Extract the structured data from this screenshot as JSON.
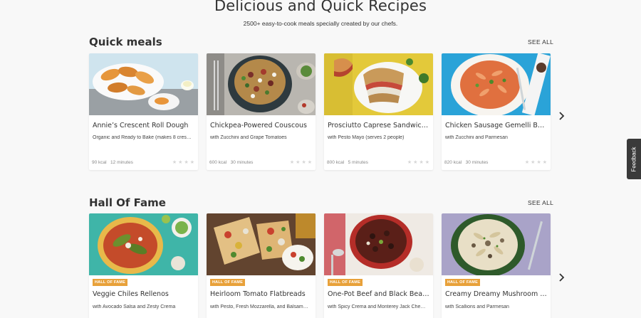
{
  "hero": {
    "title": "Delicious and Quick Recipes",
    "subtitle": "2500+ easy-to-cook meals specially created by our chefs."
  },
  "sections": [
    {
      "title": "Quick meals",
      "see_all": "SEE ALL",
      "cards": [
        {
          "title": "Annie’s Crescent Roll Dough",
          "subtitle": "Organic and Ready to Bake (makes 8 cres…",
          "kcal": "90 kcal",
          "time": "12 minutes",
          "image": "crescent-rolls"
        },
        {
          "title": "Chickpea-Powered Couscous",
          "subtitle": "with Zucchini and Grape Tomatoes",
          "kcal": "600 kcal",
          "time": "30 minutes",
          "image": "couscous"
        },
        {
          "title": "Prosciutto Caprese Sandwiches",
          "subtitle": "with Pesto Mayo (serves 2 people)",
          "kcal": "800 kcal",
          "time": "5 minutes",
          "image": "sandwiches"
        },
        {
          "title": "Chicken Sausage Gemelli Bolo…",
          "subtitle": "with Zucchini and Parmesan",
          "kcal": "820 kcal",
          "time": "30 minutes",
          "image": "gemelli"
        }
      ]
    },
    {
      "title": "Hall Of Fame",
      "see_all": "SEE ALL",
      "badge": "HALL OF FAME",
      "cards": [
        {
          "title": "Veggie Chiles Rellenos",
          "subtitle": "with Avocado Salsa and Zesty Crema",
          "image": "chiles"
        },
        {
          "title": "Heirloom Tomato Flatbreads",
          "subtitle": "with Pesto, Fresh Mozzarella, and Balsam…",
          "image": "flatbreads"
        },
        {
          "title": "One-Pot Beef and Black Bean …",
          "subtitle": "with Spicy Crema and Monterey Jack Che…",
          "image": "beef-beans"
        },
        {
          "title": "Creamy Dreamy Mushroom G…",
          "subtitle": "with Scallions and Parmesan",
          "image": "mushroom-pasta"
        }
      ]
    }
  ],
  "feedback": "Feedback",
  "icons": {
    "next": "chevron-right-icon",
    "star": "star-icon"
  },
  "colors": {
    "badge": "#e8a13a",
    "background": "#f8f8f8",
    "feedback_tab": "#3a3a3a"
  }
}
